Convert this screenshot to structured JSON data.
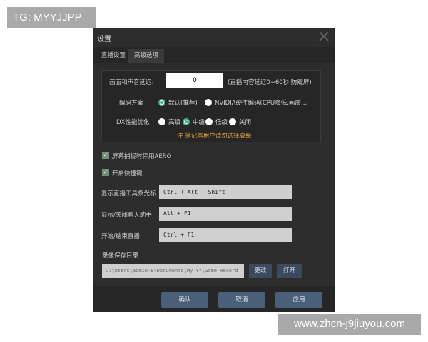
{
  "watermarks": {
    "top_left": "TG: MYYJJPP",
    "bottom_right": "www.zhcn-j9jiuyou.com"
  },
  "dialog": {
    "title": "设置",
    "close_icon": "close-icon",
    "tabs": [
      {
        "label": "直播设置",
        "active": false
      },
      {
        "label": "高级选项",
        "active": true
      }
    ],
    "delay": {
      "label": "画面和声音延迟:",
      "value": "0",
      "hint": "(直播内容延迟0~60秒,防窥屏)"
    },
    "encoding": {
      "label": "编码方案",
      "options": [
        {
          "label": "默认(推荐)",
          "selected": true
        },
        {
          "label": "NVIDIA硬件编码(CPU降低,画质…",
          "selected": false
        }
      ]
    },
    "dx": {
      "label": "DX性能优化",
      "options": [
        {
          "label": "高级",
          "selected": false
        },
        {
          "label": "中级",
          "selected": true
        },
        {
          "label": "低级",
          "selected": false
        },
        {
          "label": "关闭",
          "selected": false
        }
      ]
    },
    "note": "注  笔记本用户请勿选择高级",
    "checkboxes": [
      {
        "label": "屏幕捕捉时停用AERO",
        "checked": true
      },
      {
        "label": "开启快捷键",
        "checked": true
      }
    ],
    "hotkeys": [
      {
        "label": "显示直播工具条光标",
        "value": "Ctrl + Alt + Shift"
      },
      {
        "label": "显示/关闭聊天助手",
        "value": "Alt + F1"
      },
      {
        "label": "开始/结束直播",
        "value": "Ctrl + F1"
      }
    ],
    "record": {
      "label": "录像保存目录",
      "path": "C:\\Users\\admin-B\\Documents\\My YY\\Game Record",
      "change_label": "更改",
      "open_label": "打开"
    },
    "buttons": {
      "ok": "确认",
      "cancel": "取消",
      "apply": "应用"
    },
    "colors": {
      "background": "#2d2d2d",
      "accent": "#4cae8c",
      "note": "#e8a13c",
      "button": "#4a5f78"
    }
  }
}
